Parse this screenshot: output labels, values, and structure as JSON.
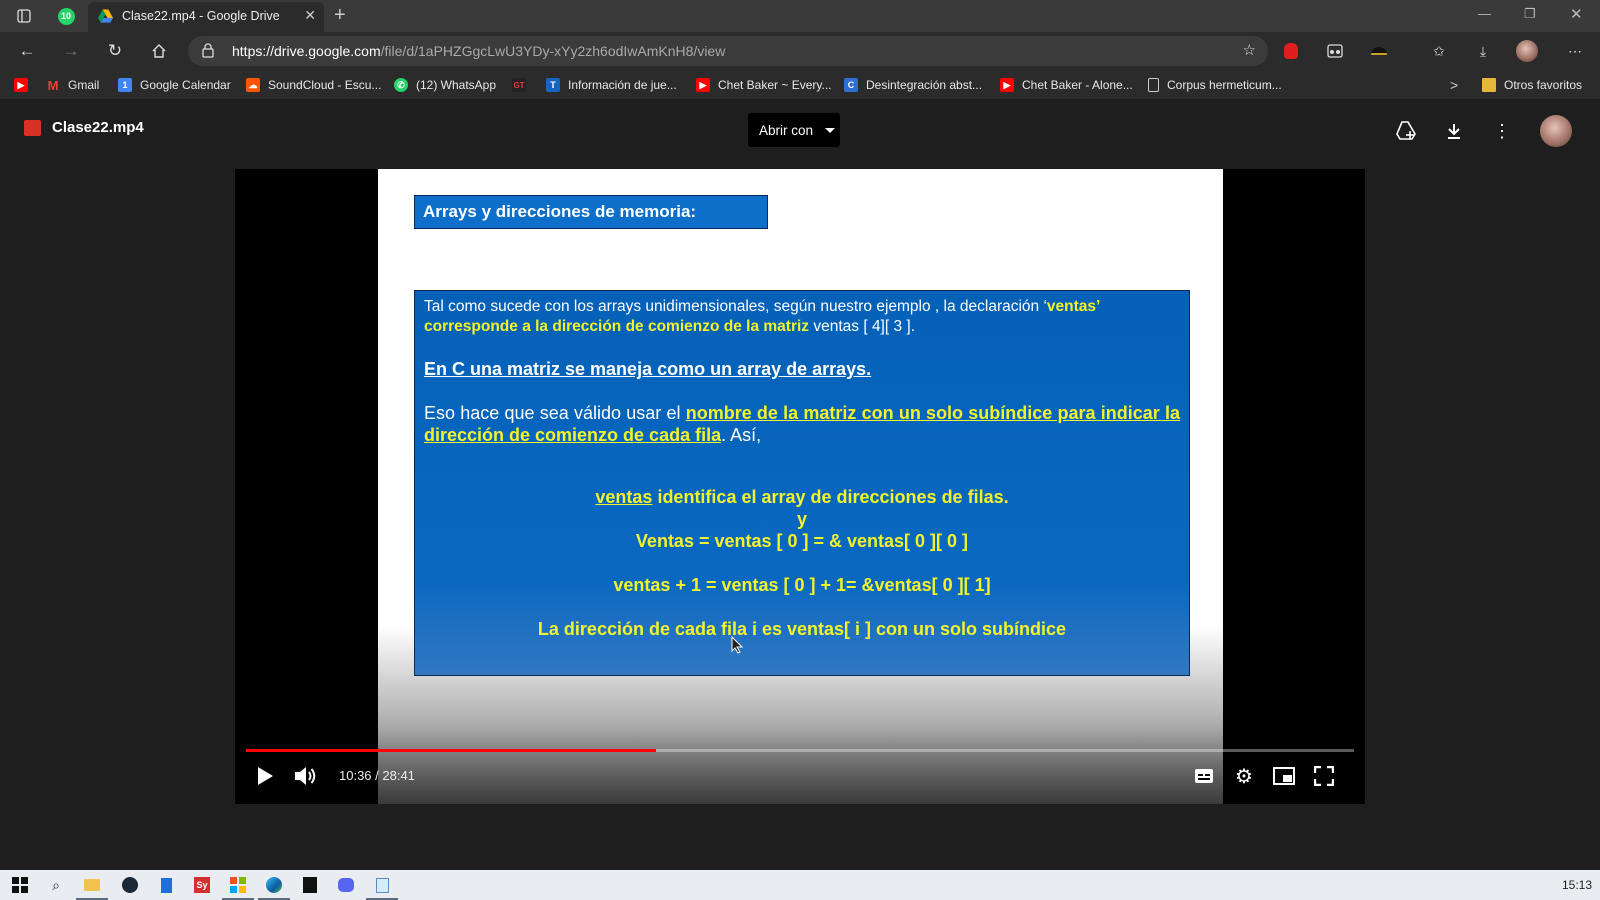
{
  "browser": {
    "tab": {
      "title": "Clase22.mp4 - Google Drive",
      "close": "✕"
    },
    "whatsapp_badge": "10",
    "new_tab": "+",
    "window": {
      "minimize": "—",
      "restore": "❐",
      "close": "✕"
    },
    "url": {
      "host": "https://drive.google.com",
      "path": "/file/d/1aPHZGgcLwU3YDy-xYy2zh6odIwAmKnH8/view"
    }
  },
  "bookmarks": [
    {
      "label": "",
      "icon": "youtube-icon",
      "color": "#ff0000"
    },
    {
      "label": "Gmail",
      "icon": "gmail-icon",
      "color": "#ea4335"
    },
    {
      "label": "Google Calendar",
      "icon": "calendar-icon",
      "color": "#4285f4"
    },
    {
      "label": "SoundCloud - Escu...",
      "icon": "soundcloud-icon",
      "color": "#ff5500"
    },
    {
      "label": "(12) WhatsApp",
      "icon": "whatsapp-icon",
      "color": "#25d366"
    },
    {
      "label": "",
      "icon": "gt-icon",
      "color": "#d32f2f"
    },
    {
      "label": "Información de jue...",
      "icon": "t-icon",
      "color": "#1565c0"
    },
    {
      "label": "Chet Baker ~ Every...",
      "icon": "youtube-icon",
      "color": "#ff0000"
    },
    {
      "label": "Desintegración abst...",
      "icon": "c-icon",
      "color": "#2f6fd1"
    },
    {
      "label": "Chet Baker - Alone...",
      "icon": "youtube-icon",
      "color": "#ff0000"
    },
    {
      "label": "Corpus hermeticum...",
      "icon": "document-icon",
      "color": "#cccccc"
    }
  ],
  "bookmarks_more": ">",
  "other_favorites": "Otros favoritos",
  "drive": {
    "file_name": "Clase22.mp4",
    "open_with": "Abrir con"
  },
  "slide": {
    "title": "Arrays y direcciones de memoria:",
    "p1_a": "Tal como sucede con los  arrays unidimensionales, según nuestro ejemplo , la declaración ‘",
    "p1_b": "ventas’",
    "p1_c": "corresponde a la dirección de comienzo de la matriz",
    "p1_d": " ventas [ 4][ 3 ].",
    "heading": "En C una matriz se maneja como un array de arrays.",
    "p2_a": "Eso hace que sea válido usar el ",
    "p2_b": "nombre de la matriz con un solo subíndice para indicar la dirección de comienzo de cada fila",
    "p2_c": ". Así,",
    "l1_a": "ventas",
    "l1_b": " identifica el  array de direcciones de filas.",
    "l2": "y",
    "l3": "Ventas  = ventas [ 0 ] = & ventas[ 0 ][ 0 ]",
    "l4": "ventas + 1 = ventas [ 0 ] + 1=  &ventas[ 0 ][ 1]",
    "l5": "La dirección de cada fila i es ventas[ i ] con un solo subíndice"
  },
  "player": {
    "time": "10:36 / 28:41",
    "progress": 0.3696,
    "accent": "#ff0000"
  },
  "taskbar": {
    "clock": "15:13"
  }
}
